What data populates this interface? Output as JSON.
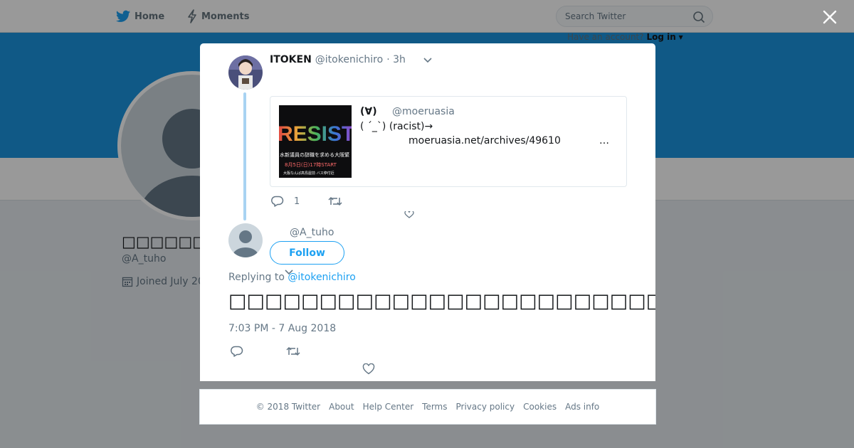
{
  "nav": {
    "home_label": "Home",
    "moments_label": "Moments",
    "search_placeholder": "Search Twitter",
    "have_account": "Have an account?",
    "login_label": "Log in",
    "brand_color": "#1da1f2"
  },
  "profile": {
    "name": "□□□□□□□",
    "handle": "@A_tuho",
    "joined": "Joined July 20"
  },
  "parent_tweet": {
    "fullname": "ITOKEN",
    "handle": "@itokenichiro",
    "time": "· 3h",
    "quote": {
      "name": "(∀)",
      "handle": "@moeruasia",
      "text": "( ´_`) (racist)→",
      "link": "moeruasia.net/archives/49610",
      "ellipsis": "…",
      "image_text": "RESIST",
      "image_caption_1": "水新議員の辞職を求める大阪緊",
      "image_caption_2": "8月5日(日)17時START",
      "image_caption_3": "大阪なんば高島屋前 バス停付近"
    },
    "reply_count": "1"
  },
  "reply_tweet": {
    "handle": "@A_tuho",
    "follow_label": "Follow",
    "replying_prefix": "Replying to",
    "replying_to": "@itokenichiro",
    "text": "□□□□□□□□□□□□□□□□□□□□□□□□□□□□□□□□□□□□□□□□□□□□□□□□□□□□□□□□□□□□□□□□□□□□□□□□□□□□□□□□",
    "timestamp": "7:03 PM - 7 Aug 2018"
  },
  "footer": {
    "links": [
      "© 2018 Twitter",
      "About",
      "Help Center",
      "Terms",
      "Privacy policy",
      "Cookies",
      "Ads info"
    ]
  }
}
